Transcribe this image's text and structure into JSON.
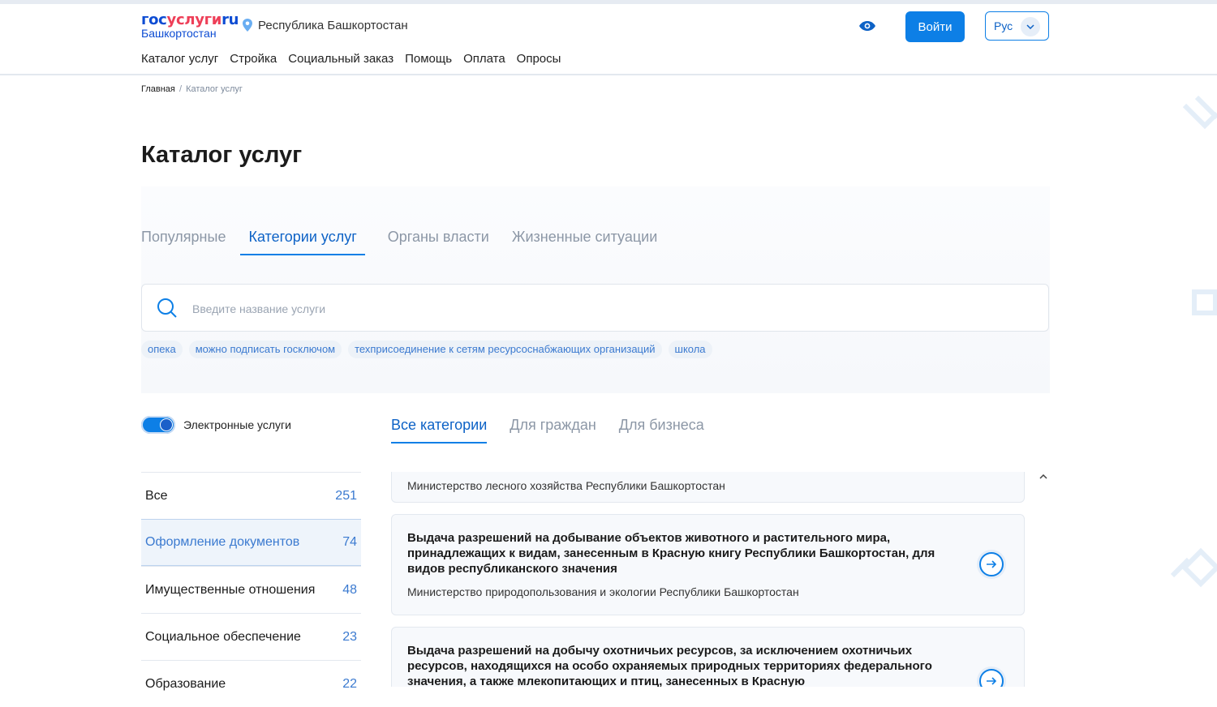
{
  "logo": {
    "part1": "гос",
    "part2": "услуги",
    "part3": "ru",
    "subtitle": "Башкортостан"
  },
  "header": {
    "region": "Республика Башкортостан",
    "nav": [
      "Каталог услуг",
      "Стройка",
      "Социальный заказ",
      "Помощь",
      "Оплата",
      "Опросы"
    ],
    "login_label": "Войти",
    "lang_label": "Рус"
  },
  "breadcrumb": {
    "home": "Главная",
    "separator": "/",
    "current": "Каталог услуг"
  },
  "page_title": "Каталог услуг",
  "tabs": [
    "Популярные",
    "Категории услуг",
    "Органы власти",
    "Жизненные ситуации"
  ],
  "active_tab": "Категории услуг",
  "search": {
    "placeholder": "Введите название услуги",
    "value": ""
  },
  "chips": [
    "опека",
    "можно подписать госключом",
    "техприсоединение к сетям ресурсоснабжающих организаций",
    "школа"
  ],
  "electronic_toggle": {
    "label": "Электронные услуги",
    "on": true
  },
  "category_tabs": [
    "Все категории",
    "Для граждан",
    "Для бизнеса"
  ],
  "categories": [
    {
      "name": "Все",
      "count": "251"
    },
    {
      "name": "Оформление документов",
      "count": "74"
    },
    {
      "name": "Имущественные отношения",
      "count": "48"
    },
    {
      "name": "Социальное обеспечение",
      "count": "23"
    },
    {
      "name": "Образование",
      "count": "22"
    }
  ],
  "active_category": "Оформление документов",
  "services": [
    {
      "title": "",
      "org": "Министерство лесного хозяйства Республики Башкортостан"
    },
    {
      "title": "Выдача разрешений на добывание объектов животного и растительного мира, принадлежащих к видам, занесенным в Красную книгу Республики Башкортостан, для видов республиканского значения",
      "org": "Министерство природопользования и экологии Республики Башкортостан"
    },
    {
      "title": "Выдача разрешений на добычу охотничьих ресурсов, за исключением охотничьих ресурсов, находящихся на особо охраняемых природных территориях федерального значения, а также млекопитающих и птиц, занесенных в Красную",
      "org": ""
    }
  ],
  "colors": {
    "accent": "#0d7fe6",
    "brand_blue": "#0d4cd3",
    "brand_red": "#ee3f58"
  },
  "icons": [
    "location-pin-icon",
    "eye-icon",
    "chevron-down-icon",
    "search-icon",
    "arrow-right-icon",
    "chevron-up-icon"
  ]
}
